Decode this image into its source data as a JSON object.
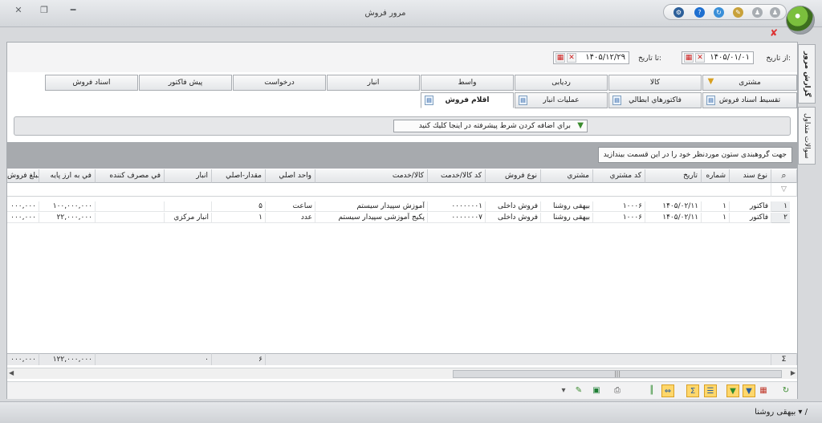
{
  "window": {
    "title": "مرور فروش",
    "close_glyph": "✕",
    "restore_glyph": "❐",
    "minimize_glyph": "━"
  },
  "quick_access": {
    "icons": [
      "settings-icon",
      "help-icon",
      "refresh-icon",
      "note-icon",
      "user-icon",
      "user-icon-2"
    ]
  },
  "side_tabs": [
    "گزارش مرور",
    "سوالات متداول"
  ],
  "date_range": {
    "from_label": "از تاریخ:",
    "from_value": "۱۴۰۵/۰۱/۰۱",
    "to_label": "تا تاریخ:",
    "to_value": "۱۴۰۵/۱۲/۲۹"
  },
  "tabs_row1": [
    "مشتری",
    "کالا",
    "واسط",
    "درخواست",
    "پیش فاکتور",
    "اسناد فروش",
    "ردیابی",
    "انبار"
  ],
  "tabs_row2": [
    "تقسیط اسناد فروش",
    "فاکتورهاي ابطالي",
    "عمليات انبار",
    "اقلام فروش"
  ],
  "active_tab": "اقلام فروش",
  "filter": {
    "button_label": "براي اضافه كردن شرط پيشرفته در اينجا كليك كنيد"
  },
  "group_panel": {
    "hint": "جهت گروهبندی ستون موردنظر خود را در این قسمت بیندازید"
  },
  "columns": [
    "نوع سند",
    "شماره",
    "تاریخ",
    "کد مشتري",
    "مشتري",
    "نوع فروش",
    "کد کالا/خدمت",
    "کالا/خدمت",
    "واحد اصلي",
    "مقدار-اصلي",
    "انبار",
    "في مصرف كننده",
    "في به ارز پایه",
    "مبلغ فروش"
  ],
  "rows": [
    {
      "index": "۱",
      "cells": [
        "فاکتور",
        "۱",
        "۱۴۰۵/۰۲/۱۱",
        "۱۰۰۰۶",
        "بیهقی روشنا",
        "فروش داخلی",
        "۰۰۰۰۰۰۰۱",
        "آموزش سپیدار سیستم",
        "ساعت",
        "۵",
        "",
        "",
        "۱۰۰,۰۰۰,۰۰۰",
        "۰۰۰,۰۰۰"
      ]
    },
    {
      "index": "۲",
      "cells": [
        "فاکتور",
        "۱",
        "۱۴۰۵/۰۲/۱۱",
        "۱۰۰۰۶",
        "بیهقی روشنا",
        "فروش داخلی",
        "۰۰۰۰۰۰۰۷",
        "پکیج آموزشی سپیدار سیستم",
        "عدد",
        "۱",
        "انبار مرکزي",
        "",
        "۲۲,۰۰۰,۰۰۰",
        "۰۰۰,۰۰۰"
      ]
    }
  ],
  "footer": {
    "sigma": "Σ",
    "qty_total": "۶",
    "consumer_total": "۰",
    "base_total": "۱۲۲,۰۰۰,۰۰۰",
    "amount_total": "۰۰۰,۰۰۰"
  },
  "status": {
    "user": "بیهقی روشنا ▾ /"
  }
}
